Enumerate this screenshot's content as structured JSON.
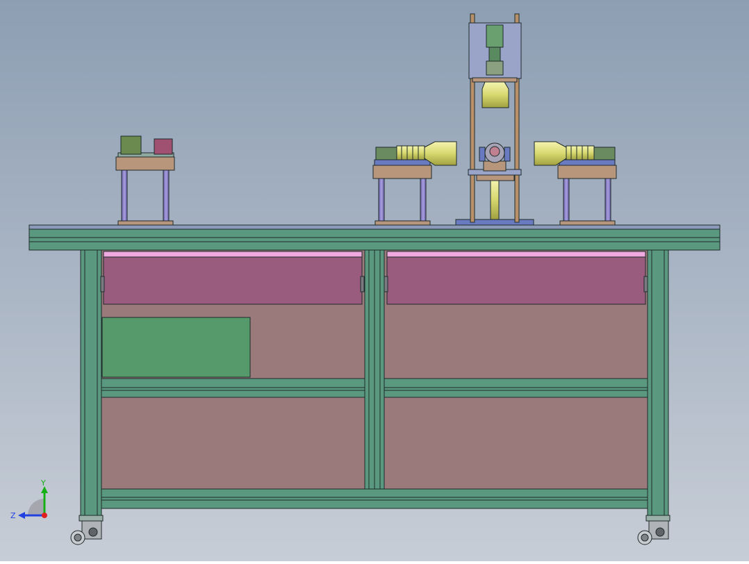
{
  "viewport": {
    "background_top": "#8d9eb3",
    "background_bottom": "#c7cdd6"
  },
  "colors": {
    "frame": "#5a9880",
    "frame_dark": "#2f6650",
    "frame_light": "#7cb9a0",
    "panel": "#9b7a7c",
    "drawer_front": "#9a5c7e",
    "drawer_top": "#f0a8e0",
    "electrical_box": "#569a6c",
    "bracket": "#b8967c",
    "rod": "#8c80c0",
    "camera_gold": "#d8d870",
    "blue_plate": "#6a7ac0",
    "outline": "#1e2a2a"
  },
  "triad": {
    "axes": [
      {
        "name": "Y",
        "color": "#16b016"
      },
      {
        "name": "Z",
        "color": "#2040e0"
      }
    ],
    "origin_color": "#e02020"
  },
  "parts": {
    "left_station": {
      "box_a": "#6a8a50",
      "box_b": "#a05070"
    },
    "casters": 2,
    "drawers": 2
  }
}
